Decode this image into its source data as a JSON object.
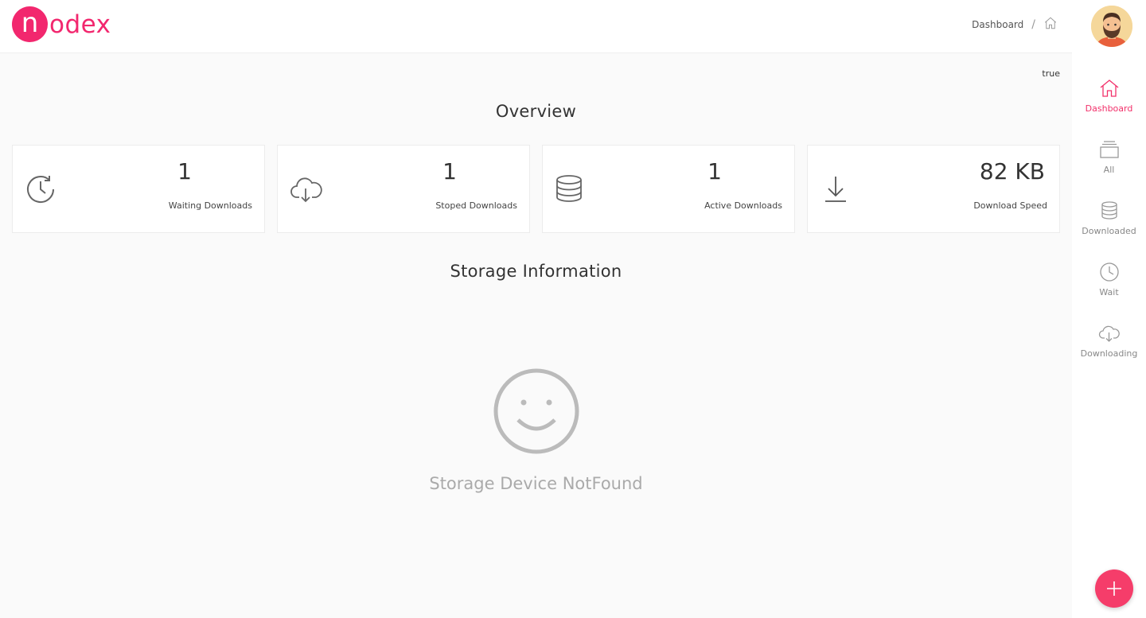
{
  "app": {
    "logo_letter": "n",
    "logo_rest": "odex"
  },
  "header": {
    "breadcrumb": {
      "current": "Dashboard",
      "separator": "/"
    }
  },
  "status_text": "true",
  "overview": {
    "title": "Overview",
    "cards": [
      {
        "icon": "clock-refresh-icon",
        "value": "1",
        "label": "Waiting Downloads"
      },
      {
        "icon": "cloud-download-icon",
        "value": "1",
        "label": "Stoped Downloads"
      },
      {
        "icon": "database-icon",
        "value": "1",
        "label": "Active Downloads"
      },
      {
        "icon": "download-arrow-icon",
        "value": "82 KB",
        "label": "Download Speed"
      }
    ]
  },
  "storage": {
    "title": "Storage Information",
    "empty_text": "Storage Device NotFound",
    "empty_icon": "smiley-icon"
  },
  "sidebar": {
    "items": [
      {
        "label": "Dashboard",
        "icon": "home-icon",
        "active": true
      },
      {
        "label": "All",
        "icon": "stack-icon",
        "active": false
      },
      {
        "label": "Downloaded",
        "icon": "database-icon",
        "active": false
      },
      {
        "label": "Wait",
        "icon": "clock-icon",
        "active": false
      },
      {
        "label": "Downloading",
        "icon": "cloud-download-icon",
        "active": false
      }
    ]
  },
  "colors": {
    "brand": "#f2276e",
    "active": "#f2306a",
    "fab": "#f53d6a",
    "background": "#fafafa"
  }
}
